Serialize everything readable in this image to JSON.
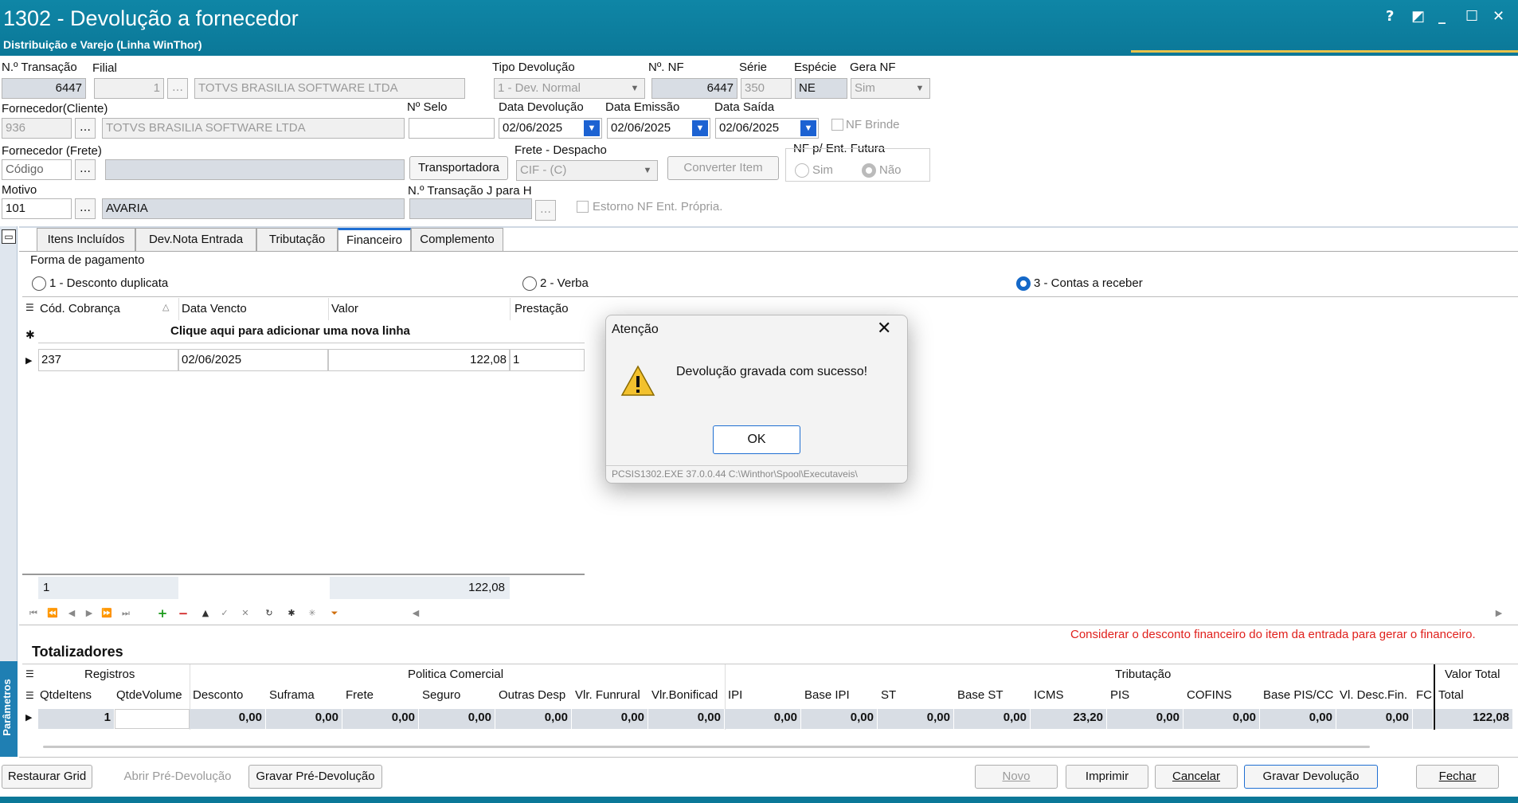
{
  "window": {
    "title": "1302 - Devolução a fornecedor",
    "subtitle": "Distribuição e Varejo (Linha WinThor)",
    "controls": [
      "?",
      "◩",
      "_",
      "☐",
      "✕"
    ]
  },
  "header": {
    "transacao_label": "N.º Transação",
    "transacao_value": "6447",
    "filial_label": "Filial",
    "filial_value": "1",
    "filial_name": "TOTVS BRASILIA SOFTWARE LTDA",
    "tipo_label": "Tipo Devolução",
    "tipo_value": "1 - Dev. Normal",
    "nf_label": "Nº. NF",
    "nf_value": "6447",
    "serie_label": "Série",
    "serie_value": "350",
    "especie_label": "Espécie",
    "especie_value": "NE",
    "gera_label": "Gera NF",
    "gera_value": "Sim",
    "fornecedor_label": "Fornecedor(Cliente)",
    "fornecedor_code": "936",
    "fornecedor_name": "TOTVS BRASILIA SOFTWARE LTDA",
    "selo_label": "Nº Selo",
    "selo_value": "",
    "data_dev_label": "Data Devolução",
    "data_dev_value": "02/06/2025",
    "data_emissao_label": "Data Emissão",
    "data_emissao_value": "02/06/2025",
    "data_saida_label": "Data Saída",
    "data_saida_value": "02/06/2025",
    "nf_brinde_label": "NF Brinde",
    "frete_forn_label": "Fornecedor (Frete)",
    "frete_forn_placeholder": "Código",
    "transportadora_label": "Transportadora",
    "frete_desp_label": "Frete - Despacho",
    "frete_desp_value": "CIF - (C)",
    "converter_label": "Converter Item",
    "nf_futura_label": "NF p/ Ent. Futura",
    "sim_label": "Sim",
    "nao_label": "Não",
    "motivo_label": "Motivo",
    "motivo_code": "101",
    "motivo_name": "AVARIA",
    "transacao_j_label": "N.º Transação J para H",
    "estorno_label": "Estorno NF Ent. Própria."
  },
  "tabs": [
    "Itens Incluídos",
    "Dev.Nota Entrada",
    "Tributação",
    "Financeiro",
    "Complemento"
  ],
  "financeiro": {
    "forma_label": "Forma de pagamento",
    "options": [
      "1 - Desconto duplicata",
      "2 - Verba",
      "3 - Contas a receber"
    ],
    "selected": "3 - Contas a receber",
    "columns": [
      "Cód. Cobrança",
      "Data Vencto",
      "Valor",
      "Prestação"
    ],
    "new_row_label": "Clique aqui para adicionar uma nova linha",
    "rows": [
      {
        "cod": "237",
        "data": "02/06/2025",
        "valor": "122,08",
        "prestacao": "1"
      }
    ],
    "footer_count": "1",
    "footer_total": "122,08"
  },
  "dialog": {
    "title": "Atenção",
    "message": "Devolução gravada com sucesso!",
    "ok_label": "OK",
    "footer": "PCSIS1302.EXE 37.0.0.44 C:\\Winthor\\Spool\\Executaveis\\"
  },
  "totalizadores": {
    "title": "Totalizadores",
    "warning": "Considerar o desconto financeiro do item da entrada para gerar o financeiro.",
    "groups": [
      "Registros",
      "Politica Comercial",
      "Tributação",
      "Valor Total"
    ],
    "columns": [
      "QtdeItens",
      "QtdeVolume",
      "Desconto",
      "Suframa",
      "Frete",
      "Seguro",
      "Outras Desp",
      "Vlr. Funrural",
      "Vlr.Bonificad",
      "IPI",
      "Base IPI",
      "ST",
      "Base ST",
      "ICMS",
      "PIS",
      "COFINS",
      "Base PIS/CC",
      "Vl. Desc.Fin.",
      "FC",
      "Total"
    ],
    "values": [
      "1",
      "",
      "0,00",
      "0,00",
      "0,00",
      "0,00",
      "0,00",
      "0,00",
      "0,00",
      "0,00",
      "0,00",
      "0,00",
      "0,00",
      "23,20",
      "0,00",
      "0,00",
      "0,00",
      "0,00",
      "",
      "122,08"
    ]
  },
  "side_panel_label": "Parâmetros",
  "footer_buttons": {
    "restaurar": "Restaurar Grid",
    "abrir_pre": "Abrir Pré-Devolução",
    "gravar_pre": "Gravar Pré-Devolução",
    "novo": "Novo",
    "imprimir": "Imprimir",
    "cancelar": "Cancelar",
    "gravar": "Gravar Devolução",
    "fechar": "Fechar"
  },
  "colors": {
    "titlebar": "#0b7898",
    "accent": "#1f6fd2",
    "warning_text": "#e0201c"
  }
}
